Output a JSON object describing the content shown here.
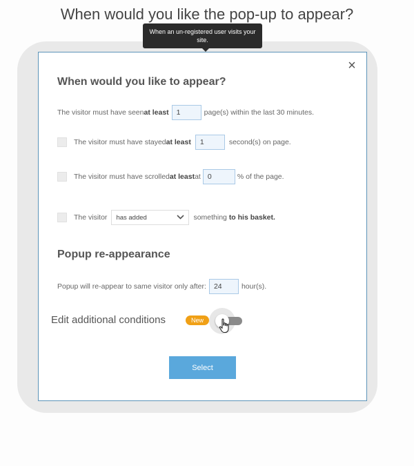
{
  "page": {
    "heading": "When would you like the pop-up to appear?"
  },
  "tooltip": {
    "text": "When an un-registered user visits your site."
  },
  "modal": {
    "close_icon": "×",
    "appear_title": "When would you like to appear?",
    "rule_pages": {
      "prefix": "The visitor must have seen ",
      "emphasis": "at least",
      "value": "1",
      "suffix": "page(s) within the last 30 minutes."
    },
    "rule_time": {
      "prefix": "The visitor must have stayed ",
      "emphasis": "at least",
      "value": "1",
      "suffix": "second(s) on page.",
      "checked": false
    },
    "rule_scroll": {
      "prefix": "The visitor must have scrolled ",
      "emphasis": "at least",
      "middle": " at",
      "value": "0",
      "suffix": "% of the page.",
      "checked": false
    },
    "rule_basket": {
      "prefix": "The visitor",
      "select_value": "has added",
      "suffix_plain": "something ",
      "suffix_bold": "to his basket.",
      "checked": false
    },
    "reappear_title": "Popup re-appearance",
    "reappear": {
      "prefix": "Popup will re-appear to same visitor only after:",
      "value": "24",
      "suffix": "hour(s)."
    },
    "conditions": {
      "label": "Edit additional conditions",
      "badge": "New",
      "toggle_on": false
    },
    "select_button": "Select"
  },
  "colors": {
    "accent": "#5aa8dc",
    "badge": "#f0a016",
    "modal_border": "#5b93b8"
  }
}
